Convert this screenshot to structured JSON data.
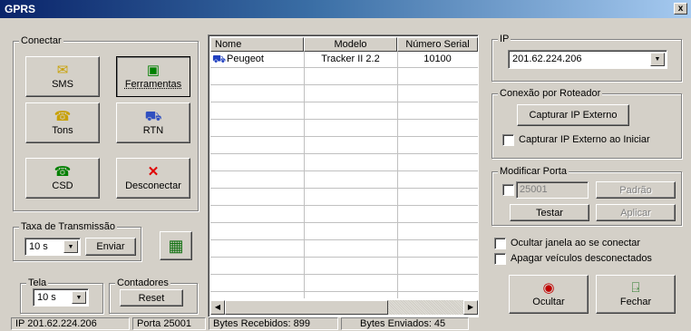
{
  "window": {
    "title": "GPRS",
    "close_glyph": "x"
  },
  "conectar": {
    "legend": "Conectar",
    "buttons": {
      "sms": {
        "label": "SMS",
        "icon": "envelope-icon"
      },
      "ferramentas": {
        "label": "Ferramentas",
        "icon": "tools-icon"
      },
      "tons": {
        "label": "Tons",
        "icon": "phone-icon"
      },
      "rtn": {
        "label": "RTN",
        "icon": "car-icon"
      },
      "csd": {
        "label": "CSD",
        "icon": "phone-icon"
      },
      "desconectar": {
        "label": "Desconectar",
        "icon": "red-x-icon"
      }
    }
  },
  "taxa": {
    "legend": "Taxa de Transmissão",
    "value": "10 s",
    "send_label": "Enviar"
  },
  "tela": {
    "legend": "Tela",
    "value": "10 s"
  },
  "contadores": {
    "legend": "Contadores",
    "reset_label": "Reset"
  },
  "table": {
    "columns": [
      "Nome",
      "Modelo",
      "Número Serial"
    ],
    "rows": [
      {
        "nome": "Peugeot",
        "modelo": "Tracker II 2.2",
        "serial": "10100"
      }
    ]
  },
  "ip": {
    "legend": "IP",
    "value": "201.62.224.206"
  },
  "roteador": {
    "legend": "Conexão por Roteador",
    "capture_label": "Capturar IP Externo",
    "capture_on_start_label": "Capturar IP Externo ao Iniciar",
    "capture_on_start_checked": false
  },
  "porta": {
    "legend": "Modificar Porta",
    "value": "25001",
    "padrao_label": "Padrão",
    "testar_label": "Testar",
    "aplicar_label": "Aplicar"
  },
  "options": {
    "ocultar_janela": "Ocultar janela ao se conectar",
    "apagar_veiculos": "Apagar veículos desconectados"
  },
  "bottom_buttons": {
    "ocultar": "Ocultar",
    "fechar": "Fechar"
  },
  "statusbar": {
    "ip": "IP 201.62.224.206",
    "porta": "Porta 25001",
    "recebidos": "Bytes Recebidos: 899",
    "enviados": "Bytes Enviados: 45"
  },
  "colors": {
    "titlebar_start": "#0a246a",
    "titlebar_end": "#a6caf0",
    "face": "#d4d0c8",
    "red_x": "#e00000",
    "green_icon": "#008000"
  }
}
